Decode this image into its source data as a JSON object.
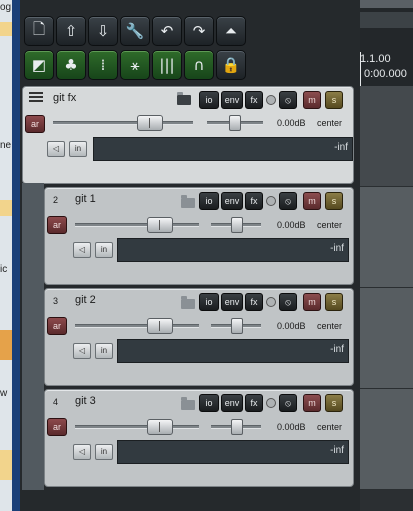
{
  "desktop": {
    "fragments": [
      "og",
      "ne",
      "ic",
      "w"
    ]
  },
  "toolbar": {
    "row1": [
      {
        "icon": "new-project-icon",
        "glyph": "🗋"
      },
      {
        "icon": "open-project-icon",
        "glyph": "⇧"
      },
      {
        "icon": "save-project-icon",
        "glyph": "⇩"
      },
      {
        "icon": "preferences-wrench-icon",
        "glyph": "🔧"
      },
      {
        "icon": "undo-icon",
        "glyph": "↶"
      },
      {
        "icon": "redo-icon",
        "glyph": "↷"
      },
      {
        "icon": "metronome-icon",
        "glyph": "⏶"
      }
    ],
    "row2": [
      {
        "icon": "auto-crossfade-icon",
        "glyph": "◩"
      },
      {
        "icon": "grouping-icon",
        "glyph": "♣"
      },
      {
        "icon": "snap-grid-icon",
        "glyph": "⁞"
      },
      {
        "icon": "ripple-editing-icon",
        "glyph": "⚹"
      },
      {
        "icon": "item-grouping-icon",
        "glyph": "|||"
      },
      {
        "icon": "loop-icon",
        "glyph": "∩"
      },
      {
        "icon": "lock-icon",
        "glyph": "🔒"
      }
    ]
  },
  "timeline": {
    "marker": "1.1.00",
    "position": "0:00.000"
  },
  "master": {
    "name": "git fx",
    "io": "io",
    "env": "env",
    "fx": "fx",
    "mute": "m",
    "solo": "s",
    "ar": "ar",
    "in": "in",
    "volume": "0.00dB",
    "pan": "center",
    "meter": "-inf",
    "volume_level_db": 0
  },
  "tracks": [
    {
      "number": "2",
      "name": "git 1",
      "io": "io",
      "env": "env",
      "fx": "fx",
      "mute": "m",
      "solo": "s",
      "ar": "ar",
      "in": "in",
      "volume": "0.00dB",
      "pan": "center",
      "meter": "-inf"
    },
    {
      "number": "3",
      "name": "git 2",
      "io": "io",
      "env": "env",
      "fx": "fx",
      "mute": "m",
      "solo": "s",
      "ar": "ar",
      "in": "in",
      "volume": "0.00dB",
      "pan": "center",
      "meter": "-inf"
    },
    {
      "number": "4",
      "name": "git 3",
      "io": "io",
      "env": "env",
      "fx": "fx",
      "mute": "m",
      "solo": "s",
      "ar": "ar",
      "in": "in",
      "volume": "0.00dB",
      "pan": "center",
      "meter": "-inf"
    }
  ],
  "colors": {
    "track_bg": "#c0c4c6",
    "mute": "#8c4d4f",
    "solo": "#8b7d47",
    "toolbar_green": "#2f6b2a",
    "window_bg": "#25292c"
  }
}
